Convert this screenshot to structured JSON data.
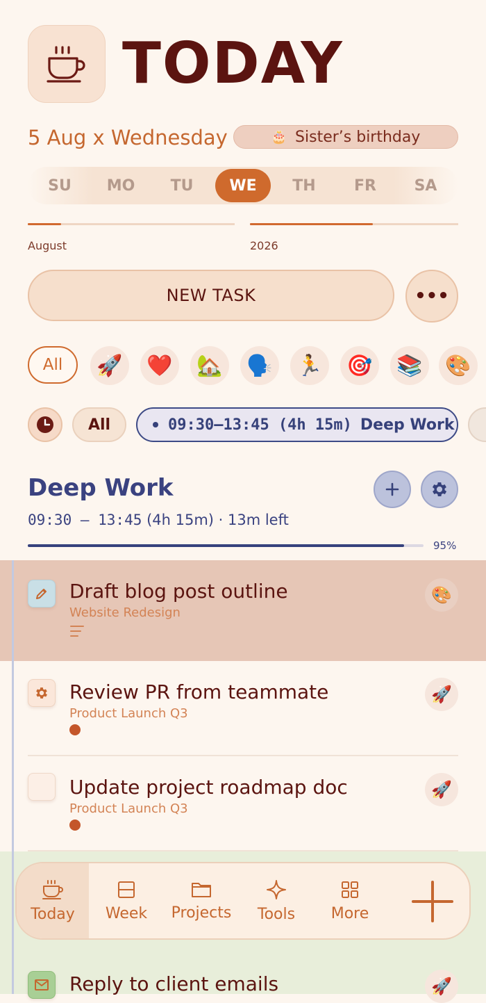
{
  "header": {
    "app_icon": "coffee-cup-icon",
    "title": "TODAY",
    "date_text": "5 Aug x Wednesday",
    "event": {
      "icon": "cake-icon",
      "emoji": "🎂",
      "label": "Sister’s birthday"
    }
  },
  "week_days": [
    {
      "label": "SU",
      "selected": false
    },
    {
      "label": "MO",
      "selected": false
    },
    {
      "label": "TU",
      "selected": false
    },
    {
      "label": "WE",
      "selected": true
    },
    {
      "label": "TH",
      "selected": false
    },
    {
      "label": "FR",
      "selected": false
    },
    {
      "label": "SA",
      "selected": false
    }
  ],
  "period_progress": [
    {
      "label": "August",
      "progress": 0.16
    },
    {
      "label": "2026",
      "progress": 0.59
    }
  ],
  "actions": {
    "new_task_label": "NEW TASK",
    "more_icon": "ellipsis-icon",
    "more_glyph": "•••"
  },
  "categories": {
    "all_label": "All",
    "items": [
      {
        "name": "rocket",
        "emoji": "🚀"
      },
      {
        "name": "heart",
        "emoji": "❤️"
      },
      {
        "name": "house",
        "emoji": "🏡"
      },
      {
        "name": "speaking-head",
        "emoji": "🗣️"
      },
      {
        "name": "runner",
        "emoji": "🏃"
      },
      {
        "name": "target",
        "emoji": "🎯"
      },
      {
        "name": "books",
        "emoji": "📚"
      },
      {
        "name": "palette",
        "emoji": "🎨"
      }
    ]
  },
  "time_filter": {
    "clock_icon": "clock-icon",
    "all_label": "All",
    "block_time": "09:30–13:45 (4h 15m)",
    "block_name": "Deep Work"
  },
  "block": {
    "title": "Deep Work",
    "time_range": "09:30 — 13:45",
    "details": "(4h 15m) · 13m left",
    "progress_label": "95%",
    "progress": 0.95,
    "accent_color": "#37427d"
  },
  "tasks": [
    {
      "title": "Draft blog post outline",
      "project": "Website Redesign",
      "status_icon": "pencil-icon",
      "meta_icon": "notes-lines-icon",
      "category_emoji": "🎨",
      "highlighted": true
    },
    {
      "title": "Review PR from teammate",
      "project": "Product Launch Q3",
      "status_icon": "gear-icon",
      "meta_icon": "priority-dot-icon",
      "category_emoji": "🚀",
      "highlighted": false
    },
    {
      "title": "Update project roadmap doc",
      "project": "Product Launch Q3",
      "status_icon": "",
      "meta_icon": "priority-dot-icon",
      "category_emoji": "🚀",
      "highlighted": false
    },
    {
      "title": "Reply to client emails",
      "project": "",
      "status_icon": "envelope-icon",
      "meta_icon": "",
      "category_emoji": "🚀",
      "highlighted": false
    }
  ],
  "nav": {
    "items": [
      {
        "label": "Today",
        "icon": "coffee-cup-icon",
        "active": true
      },
      {
        "label": "Week",
        "icon": "calendar-week-icon",
        "active": false
      },
      {
        "label": "Projects",
        "icon": "folder-icon",
        "active": false
      },
      {
        "label": "Tools",
        "icon": "sparkle-icon",
        "active": false
      },
      {
        "label": "More",
        "icon": "grid-icon",
        "active": false
      }
    ],
    "add_icon": "plus-icon"
  },
  "colors": {
    "accent": "#cf6a2d",
    "block": "#3a4280",
    "highlight_row": "#e6c6b6",
    "next_block_row": "#e8eeda"
  }
}
